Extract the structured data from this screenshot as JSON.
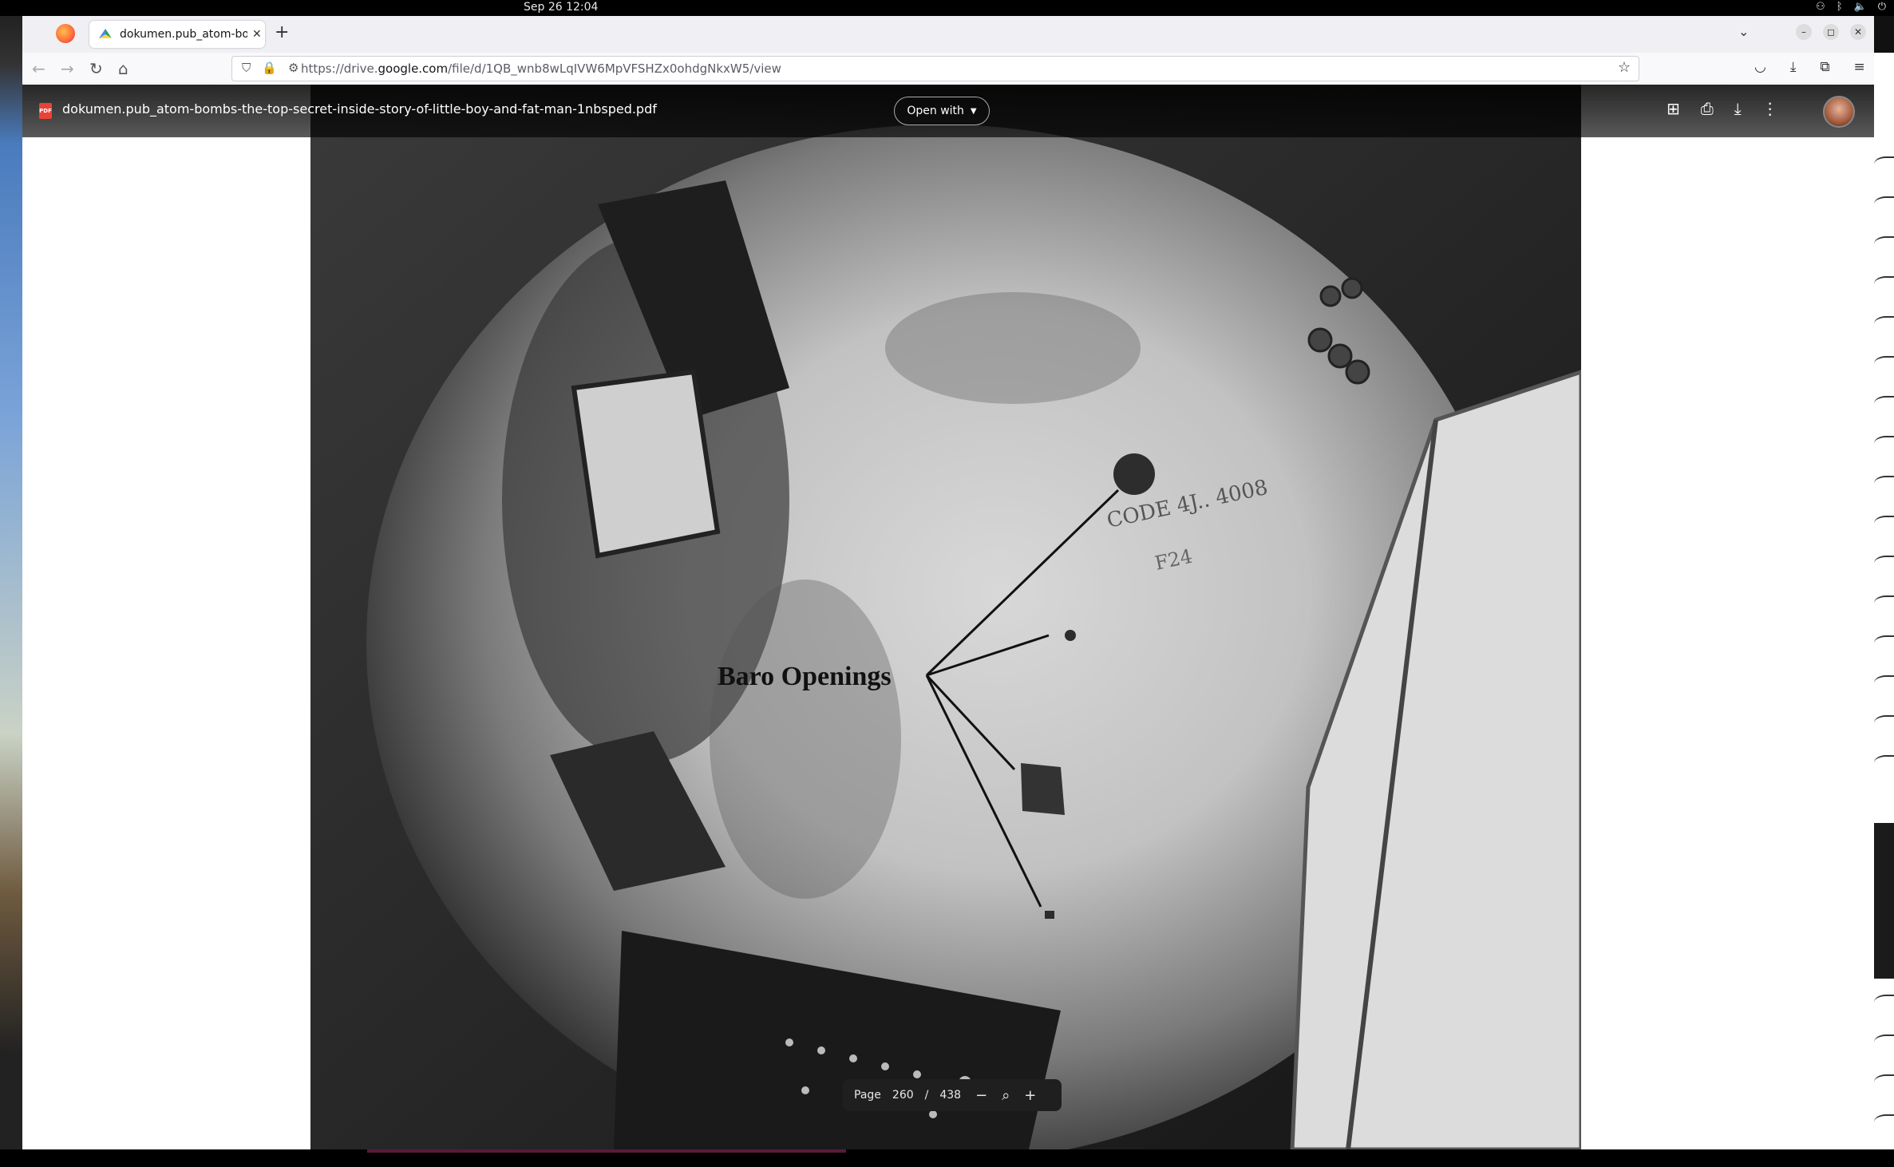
{
  "system_bar": {
    "datetime": "Sep 26  12:04"
  },
  "browser": {
    "tab_title": "dokumen.pub_atom-bom",
    "url_prefix": "https://drive.",
    "url_domain": "google.com",
    "url_path": "/file/d/1QB_wnb8wLqIVW6MpVFSHZx0ohdgNkxW5/view"
  },
  "viewer": {
    "file_name": "dokumen.pub_atom-bombs-the-top-secret-inside-story-of-little-boy-and-fat-man-1nbsped.pdf",
    "open_with_label": "Open with",
    "page_label": "Page",
    "current_page": "260",
    "page_separator": "/",
    "total_pages": "438"
  },
  "pdf_page": {
    "caption": "Baro Openings",
    "stamped_text": "CODE 4J..  4008",
    "stamped_text_2": "F24"
  },
  "colors": {
    "viewer_header": "#1f1f1f",
    "page_control": "#1f1f1f",
    "drive_accent": "#ea4335"
  }
}
